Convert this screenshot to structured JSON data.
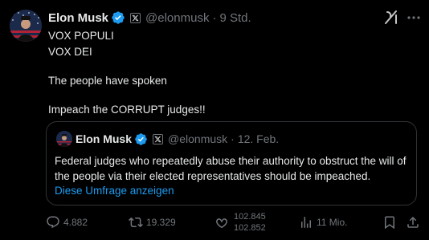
{
  "author": {
    "name": "Elon Musk",
    "handle": "@elonmusk",
    "separator": "·",
    "time": "9 Std."
  },
  "tweet": {
    "lines": [
      "VOX POPULI",
      "VOX DEI",
      "The people have spoken",
      "Impeach the CORRUPT judges!!"
    ]
  },
  "quote": {
    "name": "Elon Musk",
    "handle": "@elonmusk",
    "separator": "·",
    "time": "12. Feb.",
    "text": "Federal judges who repeatedly abuse their authority to obstruct the will of the people via their elected representatives should be impeached.",
    "poll_link": "Diese Umfrage anzeigen"
  },
  "actions": {
    "replies": "4.882",
    "reposts": "19.329",
    "likes_old": "102.845",
    "likes_new": "102.852",
    "views": "11 Mio."
  },
  "icons": {
    "verified": "verified-badge-icon",
    "affiliate": "x-affiliate-icon",
    "grok": "grok-icon",
    "more": "more-icon",
    "reply": "reply-icon",
    "repost": "repost-icon",
    "like": "like-icon",
    "views": "views-icon",
    "bookmark": "bookmark-icon",
    "share": "share-icon"
  },
  "colors": {
    "background": "#000000",
    "text": "#e7e9ea",
    "muted": "#71767b",
    "accent": "#1d9bf0",
    "border": "#2f3336"
  }
}
